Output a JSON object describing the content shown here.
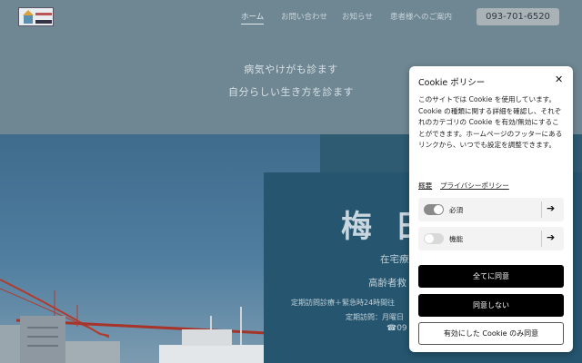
{
  "header": {
    "logo_icon": "clinic-logo",
    "nav": [
      "ホーム",
      "お問い合わせ",
      "お知らせ",
      "患者様へのご案内"
    ],
    "active_nav": "ホーム",
    "phone_button": "093-701-6520"
  },
  "hero": {
    "tagline_1": "病気やけがも診ます",
    "tagline_2": "自分らしい生き方を診ます",
    "name": "梅 田",
    "line_1": "在宅療",
    "line_2": "高齢者救",
    "line_3": "定期訪問診療＋緊急時24時間往",
    "line_4": "定期訪問：月曜日",
    "line_5": "☎09"
  },
  "cookie": {
    "title": "Cookie ポリシー",
    "close_icon": "close-icon",
    "body": "このサイトでは Cookie を使用しています。Cookie の種類に関する詳細を確認し、それぞれのカテゴリの Cookie を有効/無効にすることができます。ホームページのフッターにあるリンクから、いつでも設定を調整できます。",
    "link_summary": "概要",
    "link_privacy": "プライバシーポリシー",
    "categories": [
      {
        "label": "必須",
        "enabled": true
      },
      {
        "label": "機能",
        "enabled": false
      }
    ],
    "btn_accept_all": "全てに同意",
    "btn_decline": "同意しない",
    "btn_accept_selected": "有効にした Cookie のみ同意"
  }
}
